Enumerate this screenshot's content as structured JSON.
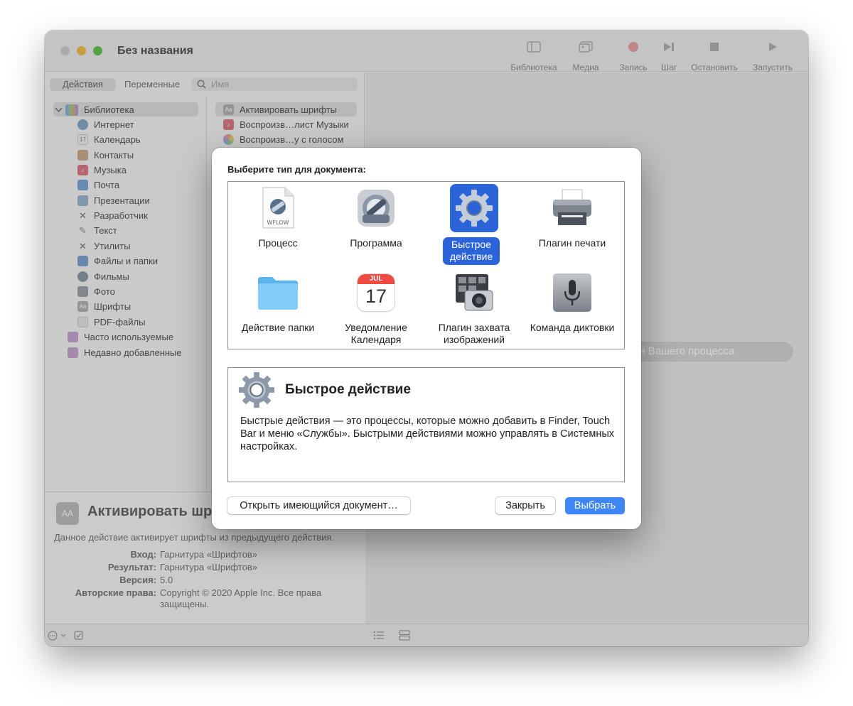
{
  "window": {
    "title": "Без названия",
    "toolbar": [
      {
        "label": "Библиотека",
        "icon": "sidebar-icon"
      },
      {
        "label": "Медиа",
        "icon": "media-icon"
      },
      {
        "label": "Запись",
        "icon": "record-icon"
      },
      {
        "label": "Шаг",
        "icon": "step-icon"
      },
      {
        "label": "Остановить",
        "icon": "stop-icon"
      },
      {
        "label": "Запустить",
        "icon": "play-icon"
      }
    ]
  },
  "left_panel": {
    "tabs": [
      "Действия",
      "Переменные"
    ],
    "search_placeholder": "Имя",
    "library": {
      "root": "Библиотека",
      "items": [
        "Интернет",
        "Календарь",
        "Контакты",
        "Музыка",
        "Почта",
        "Презентации",
        "Разработчик",
        "Текст",
        "Утилиты",
        "Файлы и папки",
        "Фильмы",
        "Фото",
        "Шрифты",
        "PDF-файлы"
      ],
      "groups": [
        "Часто используемые",
        "Недавно добавленные"
      ]
    },
    "actions": [
      "Активировать шрифты",
      "Воспроизв…лист Музыки",
      "Воспроизв…у с голосом"
    ]
  },
  "info": {
    "title": "Активировать шрифты",
    "description": "Данное действие активирует шрифты из предыдущего действия.",
    "fields": [
      {
        "key": "Вход:",
        "value": "Гарнитура «Шрифтов»"
      },
      {
        "key": "Результат:",
        "value": "Гарнитура «Шрифтов»"
      },
      {
        "key": "Версия:",
        "value": "5.0"
      },
      {
        "key": "Авторские права:",
        "value": "Copyright © 2020 Apple Inc. Все права защищены."
      }
    ]
  },
  "workarea": {
    "hint": "Для создания Вашего процесса."
  },
  "dialog": {
    "heading": "Выберите тип для документа:",
    "types": [
      {
        "label": "Процесс",
        "icon": "workflow-file-icon"
      },
      {
        "label": "Программа",
        "icon": "application-icon"
      },
      {
        "label": "Быстрое действие",
        "icon": "quick-action-gear-icon",
        "selected": true
      },
      {
        "label": "Плагин печати",
        "icon": "printer-icon"
      },
      {
        "label": "Действие папки",
        "icon": "folder-icon"
      },
      {
        "label": "Уведомление Календаря",
        "icon": "calendar-icon"
      },
      {
        "label": "Плагин захвата изображений",
        "icon": "image-capture-icon"
      },
      {
        "label": "Команда диктовки",
        "icon": "microphone-icon"
      }
    ],
    "calendar_icon": {
      "month": "JUL",
      "day": "17"
    },
    "workflow_icon_text": "WFLOW",
    "detail": {
      "title": "Быстрое действие",
      "text": "Быстрые действия — это процессы, которые можно добавить в Finder, Touch Bar и меню «Службы». Быстрыми действиями можно управлять в Системных настройках."
    },
    "buttons": {
      "open": "Открыть имеющийся документ…",
      "close": "Закрыть",
      "choose": "Выбрать"
    }
  },
  "colors": {
    "accent": "#3d86f4",
    "selection": "#2b64d8"
  }
}
